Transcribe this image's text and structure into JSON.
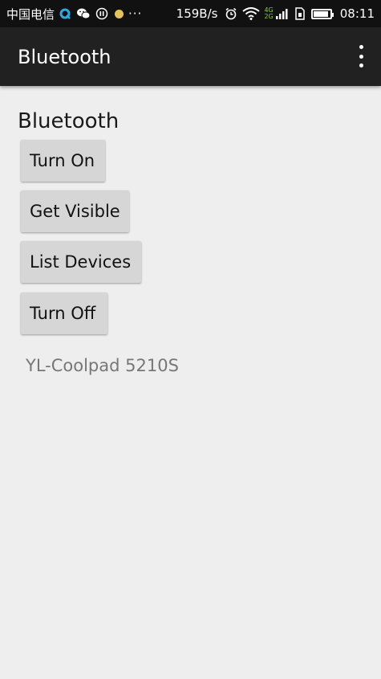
{
  "status_bar": {
    "carrier": "中国电信",
    "net_speed": "159B/s",
    "network_label_top": "4G",
    "network_label_bottom": "2G",
    "time": "08:11",
    "more": "···",
    "icons": [
      "qq-icon",
      "wechat-icon",
      "pause-icon",
      "dot-icon",
      "alarm-icon",
      "wifi-icon",
      "signal-icon",
      "sim-icon",
      "battery-icon"
    ],
    "battery_level": 0.9
  },
  "app_bar": {
    "title": "Bluetooth",
    "overflow_icon": "more-vertical-icon"
  },
  "main": {
    "heading": "Bluetooth",
    "buttons": {
      "turn_on": "Turn On",
      "get_visible": "Get Visible",
      "list_devices": "List Devices",
      "turn_off": "Turn Off"
    },
    "device_list": [
      "YL-Coolpad 5210S"
    ]
  },
  "colors": {
    "status_bar_bg": "#111111",
    "app_bar_bg": "#212121",
    "content_bg": "#eeeeee",
    "button_bg": "#d6d6d6",
    "device_text": "#777777"
  }
}
